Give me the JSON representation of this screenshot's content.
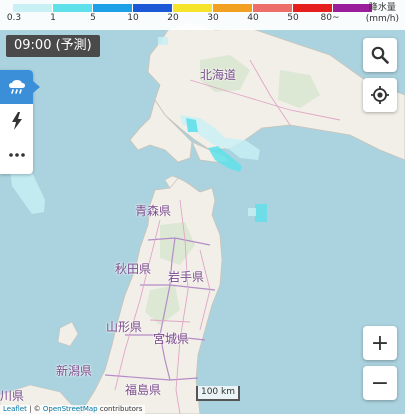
{
  "legend": {
    "title_line1": "降水量",
    "title_line2": "(mm/h)",
    "ticks": [
      "0.3",
      "1",
      "5",
      "10",
      "20",
      "30",
      "40",
      "50",
      "80~"
    ],
    "colors": [
      "#c8f0f5",
      "#5fe0ea",
      "#1ea0e6",
      "#1c59d6",
      "#f5e42a",
      "#f2a01f",
      "#ee6f6a",
      "#e51e1e",
      "#9b1f9a"
    ]
  },
  "time_badge": "09:00 (予測)",
  "side_panel": {
    "buttons": [
      "rain-cloud-icon",
      "lightning-icon",
      "more-icon"
    ]
  },
  "controls": {
    "search_icon": "search-icon",
    "locate_icon": "locate-icon",
    "zoom_in": "+",
    "zoom_out": "−"
  },
  "places": {
    "hokkaido": "北海道",
    "aomori": "青森県",
    "akita": "秋田県",
    "iwate": "岩手県",
    "yamagata": "山形県",
    "miyagi": "宮城県",
    "niigata": "新潟県",
    "fukushima": "福島県",
    "ishikawa": "川県"
  },
  "scale_label": "100 km",
  "attribution": {
    "leaflet": "Leaflet",
    "sep": " | © ",
    "osm": "OpenStreetMap",
    "rest": " contributors"
  },
  "colors": {
    "sea": "#abd3df",
    "land": "#f2efe9",
    "forest": "#dce8d4",
    "boundary": "#b48cc8",
    "rain_light": "#c8f0f5",
    "rain_mid": "#5fe0ea",
    "active_button": "#3b8fd8"
  }
}
